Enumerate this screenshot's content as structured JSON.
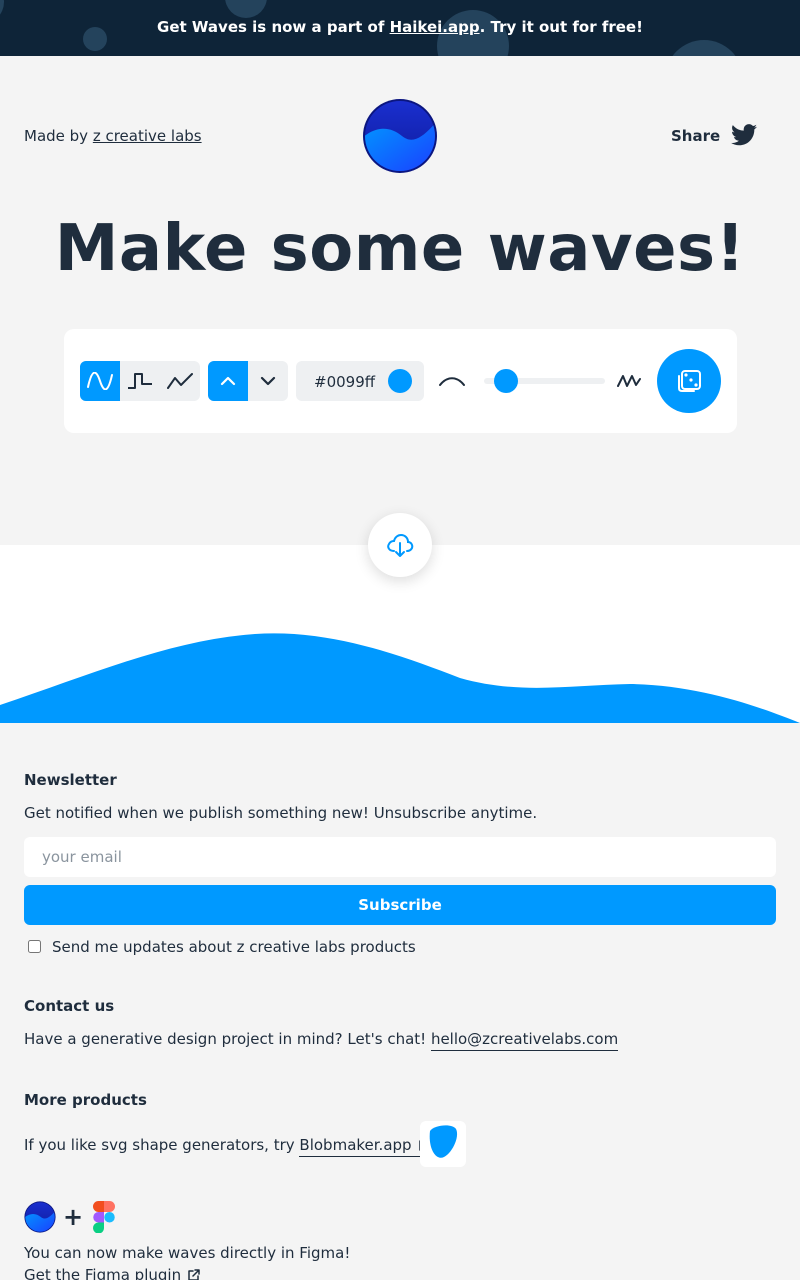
{
  "banner": {
    "prefix": "Get Waves is now a part of ",
    "link": "Haikei.app",
    "suffix": ". Try it out for free!"
  },
  "header": {
    "made_by_prefix": "Made by ",
    "made_by_link": "z creative labs",
    "share_label": "Share"
  },
  "hero": {
    "title": "Make some waves!"
  },
  "controls": {
    "wave_types": [
      "sine-wave-icon",
      "square-wave-icon",
      "triangle-wave-icon"
    ],
    "active_wave_type": "sine-wave-icon",
    "directions": [
      "chevron-up-icon",
      "chevron-down-icon"
    ],
    "active_direction": "chevron-up-icon",
    "color_value": "#0099ff",
    "complexity_fraction": 0.1
  },
  "colors": {
    "accent": "#0099ff",
    "dark": "#0e2438",
    "text": "#1f2d3d"
  },
  "newsletter": {
    "title": "Newsletter",
    "description": "Get notified when we publish something new! Unsubscribe anytime.",
    "email_placeholder": "your email",
    "subscribe_label": "Subscribe",
    "checkbox_label": "Send me updates about z creative labs products"
  },
  "contact": {
    "title": "Contact us",
    "text": "Have a generative design project in mind? Let's chat! ",
    "email": "hello@zcreativelabs.com"
  },
  "products": {
    "title": "More products",
    "text": "If you like svg shape generators, try ",
    "link": "Blobmaker.app"
  },
  "figma": {
    "text": "You can now make waves directly in Figma!",
    "link": "Get the Figma plugin"
  }
}
